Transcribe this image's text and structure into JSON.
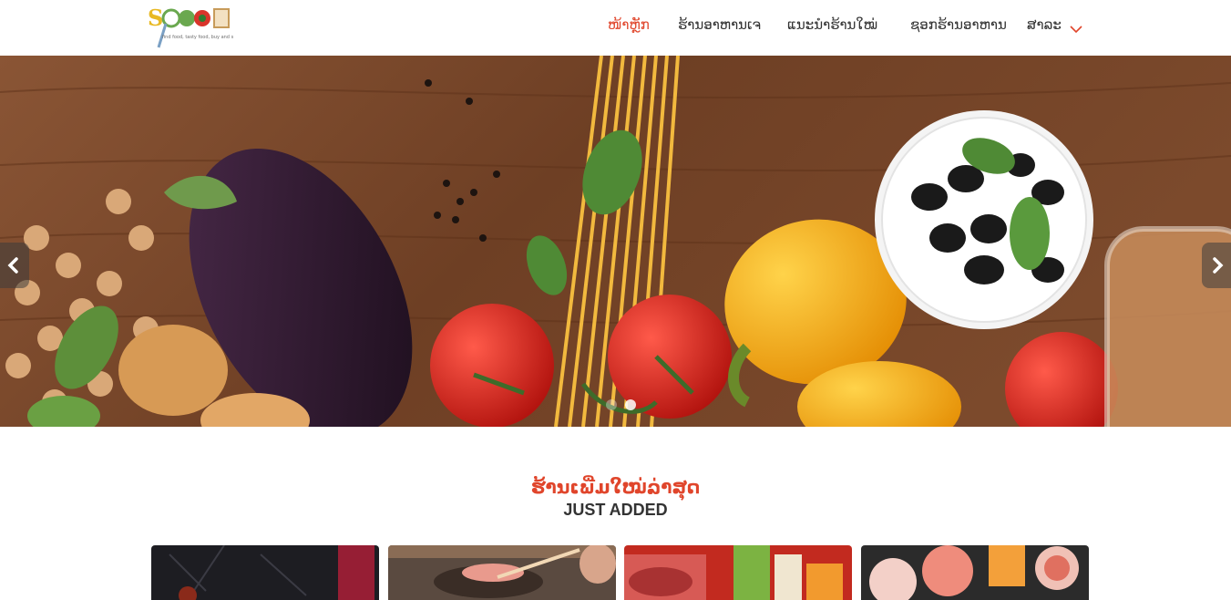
{
  "header": {
    "logo_alt": "spoon",
    "nav": [
      {
        "label": "ໜ້າຫຼັກ",
        "active": true
      },
      {
        "label": "ຮ້ານອາຫານເຈ",
        "active": false
      },
      {
        "label": "ແນະນຳຮ້ານໃໝ່",
        "active": false
      },
      {
        "label": "ຊອກຮ້ານອາຫານ",
        "active": false
      },
      {
        "label": "ສາລະ",
        "active": false
      }
    ]
  },
  "hero": {
    "slides_count": 2,
    "active_slide": 2
  },
  "section": {
    "title": "ຮ້ານເພີ່ມໃໝ່ລ່າສຸດ",
    "subtitle": "JUST ADDED"
  },
  "colors": {
    "accent": "#e0452b",
    "text": "#333333"
  },
  "icons": {
    "prev": "chevron-left-icon",
    "next": "chevron-right-icon",
    "dropdown": "chevron-down-icon"
  }
}
